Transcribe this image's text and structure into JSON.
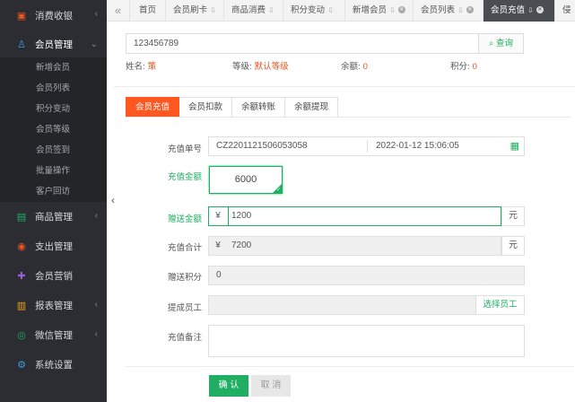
{
  "sidebar": {
    "menus": [
      {
        "icon": "receipt-icon",
        "glyph": "▣",
        "color": "#e8541e",
        "label": "消费收银",
        "chev": "‹"
      },
      {
        "icon": "user-icon",
        "glyph": "♙",
        "color": "#3c9be8",
        "label": "会员管理",
        "chev": "⌄"
      }
    ],
    "subitems": [
      "新增会员",
      "会员列表",
      "积分变动",
      "会员等级",
      "会员签到",
      "批量操作",
      "客户回访"
    ],
    "menus2": [
      {
        "icon": "goods-icon",
        "glyph": "▤",
        "color": "#1fae62",
        "label": "商品管理",
        "chev": "‹"
      },
      {
        "icon": "expense-icon",
        "glyph": "◉",
        "color": "#e8541e",
        "label": "支出管理",
        "chev": ""
      },
      {
        "icon": "gift-icon",
        "glyph": "✚",
        "color": "#a05cd8",
        "label": "会员营销",
        "chev": ""
      },
      {
        "icon": "report-icon",
        "glyph": "▥",
        "color": "#f3a215",
        "label": "报表管理",
        "chev": "‹"
      },
      {
        "icon": "wechat-icon",
        "glyph": "◎",
        "color": "#1fae62",
        "label": "微信管理",
        "chev": "‹"
      },
      {
        "icon": "settings-icon",
        "glyph": "⚙",
        "color": "#3c9be8",
        "label": "系统设置",
        "chev": ""
      }
    ]
  },
  "tabs": {
    "scroll_left": "«",
    "items": [
      "首页",
      "会员刷卡",
      "商品消费",
      "积分变动",
      "新增会员",
      "会员列表",
      "会员充值"
    ],
    "overflow": "侵"
  },
  "search": {
    "value": "123456789",
    "button": "查询"
  },
  "member_info": {
    "name_label": "姓名:",
    "name_value": "策",
    "level_label": "等级:",
    "level_value": "默认等级",
    "balance_label": "余额:",
    "balance_value": "0",
    "points_label": "积分:",
    "points_value": "0"
  },
  "subtabs": [
    "会员充值",
    "会员扣款",
    "余额转账",
    "余额提现"
  ],
  "form": {
    "order_label": "充值单号",
    "order_no": "CZ2201121506053058",
    "order_time": "2022-01-12 15:06:05",
    "amount_label": "充值金额",
    "amount": "6000",
    "bonus_label": "赠送金额",
    "bonus": "1200",
    "total_label": "充值合计",
    "total": "7200",
    "bonus_points_label": "赠送积分",
    "bonus_points": "0",
    "staff_label": "提成员工",
    "staff_button": "选择员工",
    "note_label": "充值备注",
    "currency": "¥",
    "unit": "元"
  },
  "buttons": {
    "confirm": "确 认",
    "cancel": "取 消"
  },
  "colors": {
    "accent_green": "#1fae62",
    "accent_orange": "#ff5722",
    "sidebar_bg": "#2b2d32"
  }
}
